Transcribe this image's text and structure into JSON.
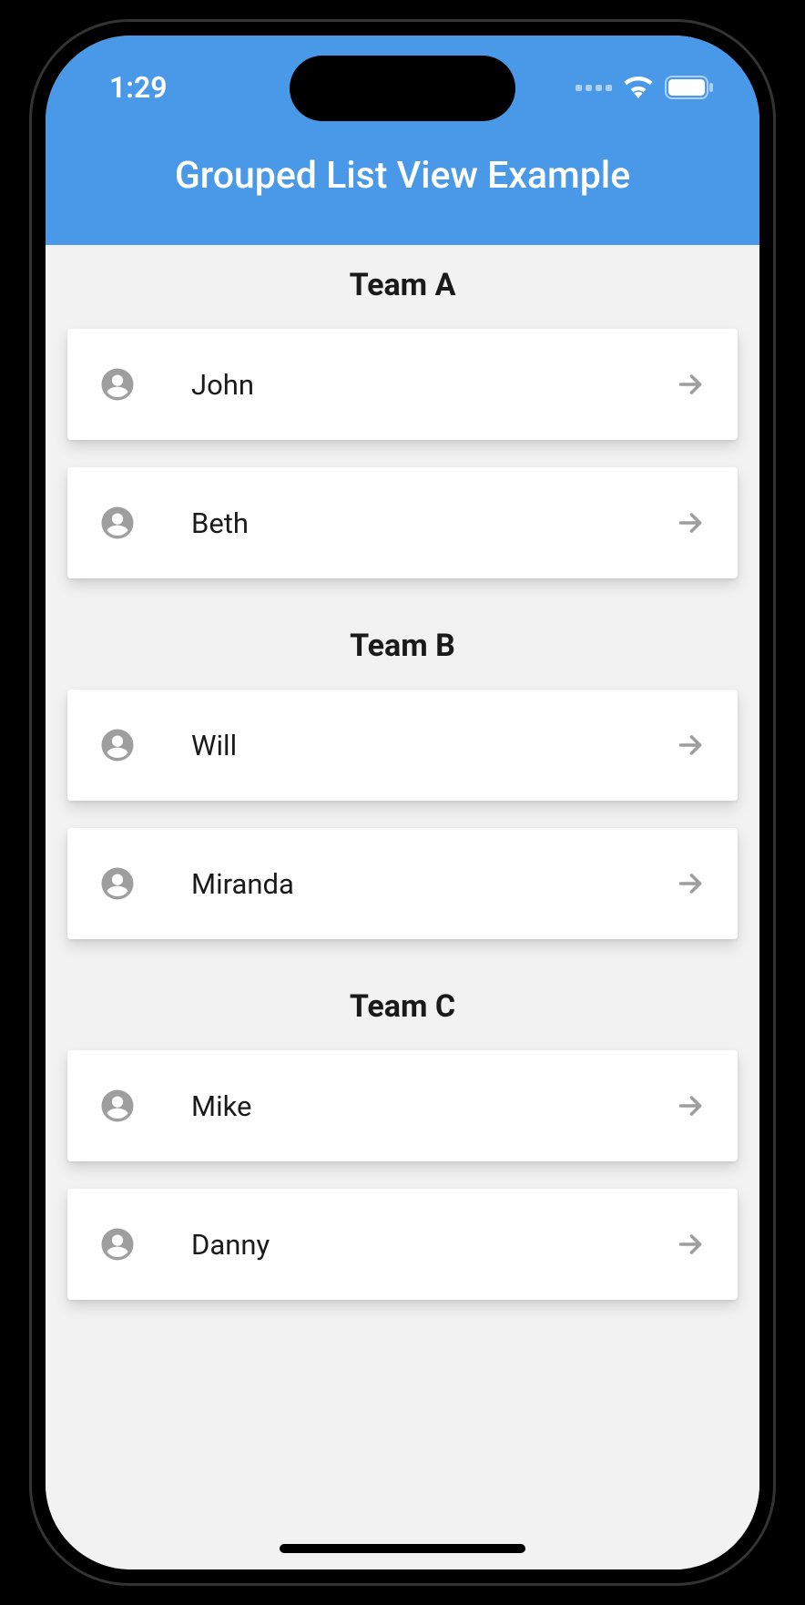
{
  "status": {
    "time": "1:29"
  },
  "header": {
    "title": "Grouped List View Example"
  },
  "groups": [
    {
      "title": "Team A",
      "items": [
        "John",
        "Beth"
      ]
    },
    {
      "title": "Team B",
      "items": [
        "Will",
        "Miranda"
      ]
    },
    {
      "title": "Team C",
      "items": [
        "Mike",
        "Danny"
      ]
    }
  ]
}
